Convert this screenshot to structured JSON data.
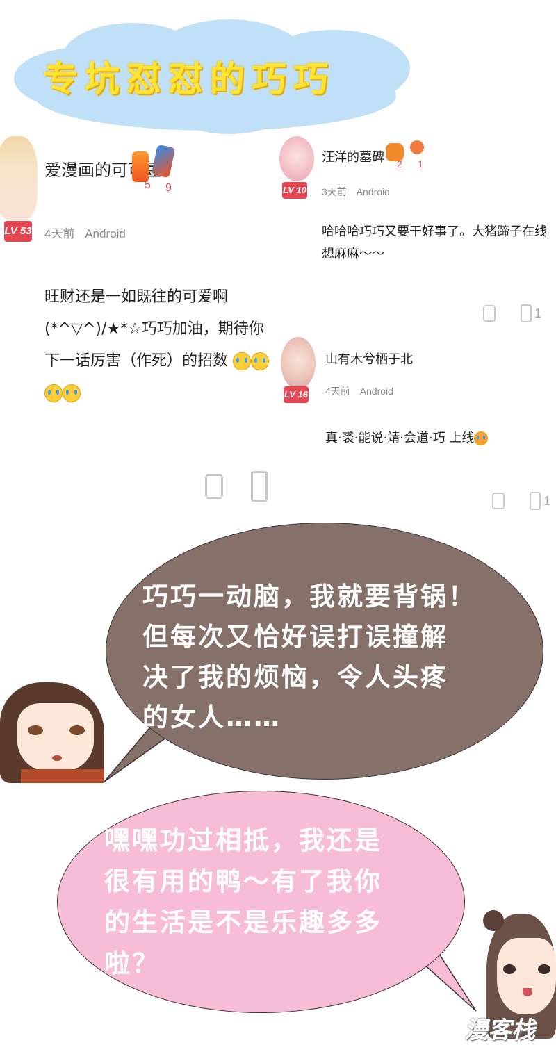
{
  "title": "专坑怼怼的巧巧",
  "comments": [
    {
      "username": "爱漫画的可可豆",
      "level": "LV 53",
      "time": "4天前",
      "platform": "Android",
      "text": "旺财还是一如既往的可爱啊(*^▽^)/★*☆巧巧加油，期待你下一话厉害（作死）的招数",
      "badges": [
        "5",
        "9"
      ],
      "likes": ""
    },
    {
      "username": "汪洋的墓碑",
      "level": "LV 10",
      "time": "3天前",
      "platform": "Android",
      "text": "哈哈哈巧巧又要干好事了。大猪蹄子在线想麻麻～～",
      "badges": [
        "2",
        "1"
      ],
      "likes": "1"
    },
    {
      "username": "山有木兮栖于北",
      "level": "LV 16",
      "time": "4天前",
      "platform": "Android",
      "text": "真·裘·能说·靖·会道·巧 上线",
      "badges": [],
      "likes": "1"
    }
  ],
  "bubbles": {
    "brown": {
      "lines": [
        "巧巧一动脑，我就要背锅！",
        "但每次又恰好误打误撞解",
        "决了我的烦恼，令人头疼",
        "的女人……"
      ],
      "color": "#857169"
    },
    "pink": {
      "lines": [
        "嘿嘿功过相抵，我还是",
        "很有用的鸭～有了我你",
        "的生活是不是乐趣多多",
        "啦？"
      ],
      "color": "#f8bdd6"
    }
  },
  "watermark": "漫客栈",
  "colors": {
    "level_badge": "#e64552",
    "title": "#ffe433",
    "cloud": "#bfe0f6"
  }
}
